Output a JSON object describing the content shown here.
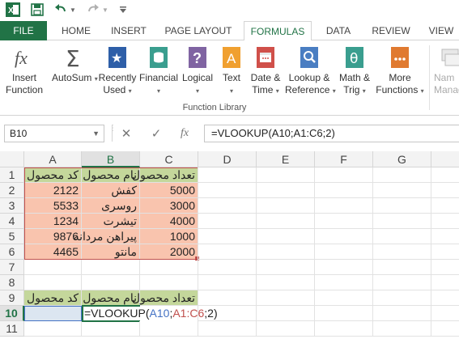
{
  "qat": {
    "icons": [
      "excel-logo-icon",
      "save-icon",
      "undo-icon",
      "undo-dropdown-icon",
      "redo-icon",
      "redo-dropdown-icon",
      "customize-qat-icon"
    ]
  },
  "tabs": [
    "FILE",
    "HOME",
    "INSERT",
    "PAGE LAYOUT",
    "FORMULAS",
    "DATA",
    "REVIEW",
    "VIEW"
  ],
  "active_tab": "FORMULAS",
  "ribbon": {
    "insert_function": [
      "Insert",
      "Function"
    ],
    "autosum": "AutoSum",
    "recently_used": [
      "Recently",
      "Used"
    ],
    "financial": "Financial",
    "logical": "Logical",
    "text": "Text",
    "date_time": [
      "Date &",
      "Time"
    ],
    "lookup_reference": [
      "Lookup &",
      "Reference"
    ],
    "math_trig": [
      "Math &",
      "Trig"
    ],
    "more_functions": [
      "More",
      "Functions"
    ],
    "name_manager": [
      "Nam",
      "Manag"
    ],
    "group_label": "Function Library",
    "colors": {
      "accent": "#217346",
      "recent_blue": "#2e5fa8",
      "financial_teal": "#3a9e8f",
      "logical_purple": "#8064a2",
      "text_orange": "#f0a030",
      "date_red": "#d0504a",
      "lookup_blue": "#4a7ec2",
      "math_teal": "#3a9e8f",
      "more_orange": "#e07a30"
    }
  },
  "formula_bar": {
    "name_box": "B10",
    "cancel": "✕",
    "enter": "✓",
    "fx": "fx",
    "formula": "=VLOOKUP(A10;A1:C6;2)"
  },
  "columns": [
    "A",
    "B",
    "C",
    "D",
    "E",
    "F",
    "G"
  ],
  "rows": [
    "1",
    "2",
    "3",
    "4",
    "5",
    "6",
    "7",
    "8",
    "9",
    "10",
    "11"
  ],
  "table": {
    "headers": {
      "A": "کد محصول",
      "B": "نام محصول",
      "C": "تعداد محصول"
    },
    "data": [
      {
        "A": "2122",
        "B": "کفش",
        "C": "5000"
      },
      {
        "A": "5533",
        "B": "روسری",
        "C": "3000"
      },
      {
        "A": "1234",
        "B": "تیشرت",
        "C": "4000"
      },
      {
        "A": "9876",
        "B": "پیراهن مردانه",
        "C": "1000"
      },
      {
        "A": "4465",
        "B": "مانتو",
        "C": "2000"
      }
    ]
  },
  "lookup_row": {
    "headers": {
      "A": "کد محصول",
      "B": "نام محصول",
      "C": "تعداد محصول"
    },
    "edit_cell": {
      "prefix": "=VLOOKUP(",
      "arg1": "A10",
      "sep1": ";",
      "arg2": "A1:C6",
      "sep2": ";",
      "arg3": "2)"
    }
  },
  "colors": {
    "header_fill": "#c4d79b",
    "data_fill": "#f9c4ae",
    "selection": "#217346"
  }
}
